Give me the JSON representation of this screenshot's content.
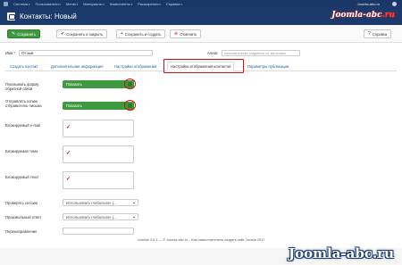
{
  "topnav": {
    "menu": [
      "Система",
      "Пользователи",
      "Меню",
      "Материалы",
      "Компоненты",
      "Расширения",
      "Справка"
    ],
    "site": "Joomla-abc.ru"
  },
  "header": {
    "title": "Контакты: Новый",
    "brand_main": "Joomla-abc",
    "brand_tld": ".ru"
  },
  "toolbar": {
    "save": "Сохранить",
    "save_close": "Сохранить и закрыть",
    "save_new": "Сохранить и создать",
    "cancel": "Отменить",
    "help": "Справка"
  },
  "fields": {
    "name_label": "Имя *",
    "name_value": "Отзыв",
    "alias_label": "Алиас",
    "alias_placeholder": "Автоматически создаётся из заголовка"
  },
  "tabs": [
    {
      "label": "Создать контакт"
    },
    {
      "label": "Дополнительная информация"
    },
    {
      "label": "Настройки отображения"
    },
    {
      "label": "Настройки отображения контактов"
    },
    {
      "label": "Параметры публикации"
    }
  ],
  "form": {
    "show_form_label": "Показывать форму обратной связи",
    "show_form_value": "Показать",
    "send_copy_label": "Отправлять копию отправителю письма",
    "send_copy_value": "Показать",
    "banned_email_label": "Блокируемый e-mail",
    "banned_subject_label": "Блокируемая тема",
    "banned_text_label": "Блокируемый текст",
    "session_check_label": "Проверять сессию",
    "session_check_value": "Использовать глобальное (...",
    "custom_reply_label": "Произвольный ответ",
    "custom_reply_value": "Использовать глобальное (...",
    "redirect_label": "Перенаправление"
  },
  "footer": {
    "text": "Joomla! 3.6.1 — © Joomla-abc.ru – Как самостоятельно создать сайт Joomla 2017"
  },
  "watermark": "Joomla-abc.ru",
  "colors": {
    "header_bg": "#1b3a6b",
    "green": "#3e9a3e",
    "highlight_red": "#d60b0b",
    "link_blue": "#1f5d99"
  }
}
